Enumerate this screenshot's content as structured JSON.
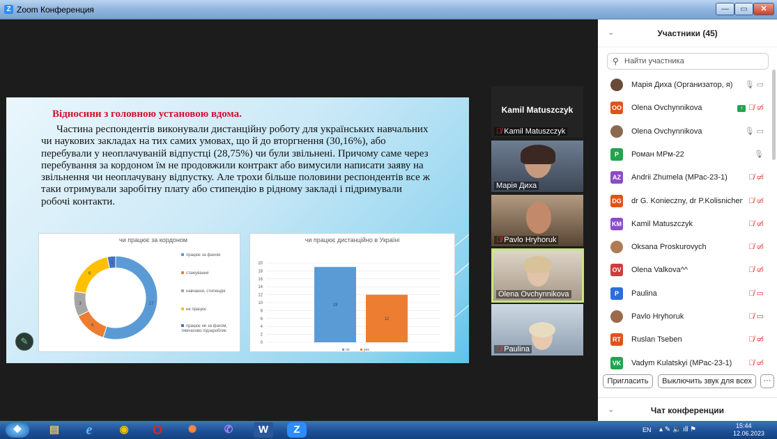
{
  "window": {
    "title": "Zoom Конференция",
    "min": "—",
    "max": "▭",
    "close": "✕"
  },
  "slide": {
    "title": "Відносини з головною установою вдома.",
    "body": "Частина респондентів виконували дистанційну роботу для українських навчальних чи наукових закладах на тих самих умовах, що й до вторгнення (30,16%), або перебували у неоплачуваній відпустці (28,75%) чи були звільнені. Причому саме через перебування за кордоном їм не продовжили контракт або вимусили написати заяву на звільнення чи неоплачувану відпустку. Але трохи більше половини респондентів все ж таки отримували заробітну плату або стипендію в рідному закладі і підримували робочі контакти."
  },
  "chart_data": [
    {
      "type": "pie",
      "title": "чи працює за кордоном",
      "categories": [
        "працює за фахом",
        "стажування",
        "навчання, стипендія",
        "не працює",
        "працює не за фахом, тимчасово підзаробляє"
      ],
      "values": [
        17,
        4,
        3,
        6,
        1
      ],
      "colors": [
        "#5b9bd5",
        "#ed7d31",
        "#a5a5a5",
        "#ffc000",
        "#4472c4"
      ]
    },
    {
      "type": "bar",
      "title": "чи працює дистанційно в Україні",
      "categories": [
        "no",
        "yes"
      ],
      "values": [
        19,
        12
      ],
      "colors": [
        "#5b9bd5",
        "#ed7d31"
      ],
      "ylim": [
        0,
        20
      ],
      "yticks": [
        "20",
        "18",
        "16",
        "14",
        "12",
        "10",
        "8",
        "6",
        "4",
        "2",
        "0"
      ]
    }
  ],
  "video_tiles": [
    {
      "header": "Kamil Matuszczyk",
      "name": "Kamil Matuszczyk",
      "muted": true
    },
    {
      "name": "Марія Диха",
      "muted": false
    },
    {
      "name": "Pavlo Hryhoruk",
      "muted": true
    },
    {
      "name": "Olena Ovchynnikova",
      "muted": false
    },
    {
      "name": "Paulina",
      "muted": true
    }
  ],
  "participants_panel": {
    "title": "Участники (45)",
    "search_placeholder": "Найти участника",
    "participants": [
      {
        "name": "Марія Диха (Организатор, я)",
        "initials": "",
        "color": "#6b4a3a",
        "photo": true,
        "icons": "🎙 ▭",
        "muted": false
      },
      {
        "name": "Olena Ovchynnikova",
        "initials": "OO",
        "color": "#e0521a",
        "photo": false,
        "icons": "🎙̸ ▭̸",
        "muted": true,
        "sharing": true
      },
      {
        "name": "Olena Ovchynnikova",
        "initials": "",
        "color": "#8a6a4e",
        "photo": true,
        "icons": "🎙 ▭",
        "muted": false
      },
      {
        "name": "Роман МРм-22",
        "initials": "P",
        "color": "#23a34e",
        "photo": false,
        "icons": "🎙",
        "muted": false
      },
      {
        "name": "Andrii Zhumela (МРас-23-1)",
        "initials": "AZ",
        "color": "#8a4cc9",
        "photo": false,
        "icons": "🎙̸ ▭̸",
        "muted": true
      },
      {
        "name": "dr G. Konieczny, dr P.Kolisnichenko",
        "initials": "DG",
        "color": "#e0521a",
        "photo": false,
        "icons": "🎙̸ ▭̸",
        "muted": true
      },
      {
        "name": "Kamil Matuszczyk",
        "initials": "KM",
        "color": "#8a4cc9",
        "photo": false,
        "icons": "🎙̸ ▭̸",
        "muted": true
      },
      {
        "name": "Oksana Proskurovych",
        "initials": "",
        "color": "#b07a52",
        "photo": true,
        "icons": "🎙̸ ▭̸",
        "muted": true
      },
      {
        "name": "Olena Valkova^^",
        "initials": "OV",
        "color": "#d13b3b",
        "photo": false,
        "icons": "🎙̸ ▭̸",
        "muted": true
      },
      {
        "name": "Paulina",
        "initials": "P",
        "color": "#2d6cdf",
        "photo": false,
        "icons": "🎙̸ ▭",
        "muted": true
      },
      {
        "name": "Pavlo Hryhoruk",
        "initials": "",
        "color": "#9a6b4b",
        "photo": true,
        "icons": "🎙̸ ▭",
        "muted": true
      },
      {
        "name": "Ruslan Tseben",
        "initials": "RT",
        "color": "#e0521a",
        "photo": false,
        "icons": "🎙̸ ▭̸",
        "muted": true
      },
      {
        "name": "Vadym Kulatskyi (МРас-23-1)",
        "initials": "VK",
        "color": "#23a34e",
        "photo": false,
        "icons": "🎙̸ ▭̸",
        "muted": true
      }
    ],
    "invite_label": "Пригласить",
    "mute_all_label": "Выключить звук для всех",
    "more_label": "···",
    "chat_title": "Чат конференции"
  },
  "taskbar": {
    "lang": "EN",
    "time": "15:44",
    "date": "12.06.2023"
  }
}
